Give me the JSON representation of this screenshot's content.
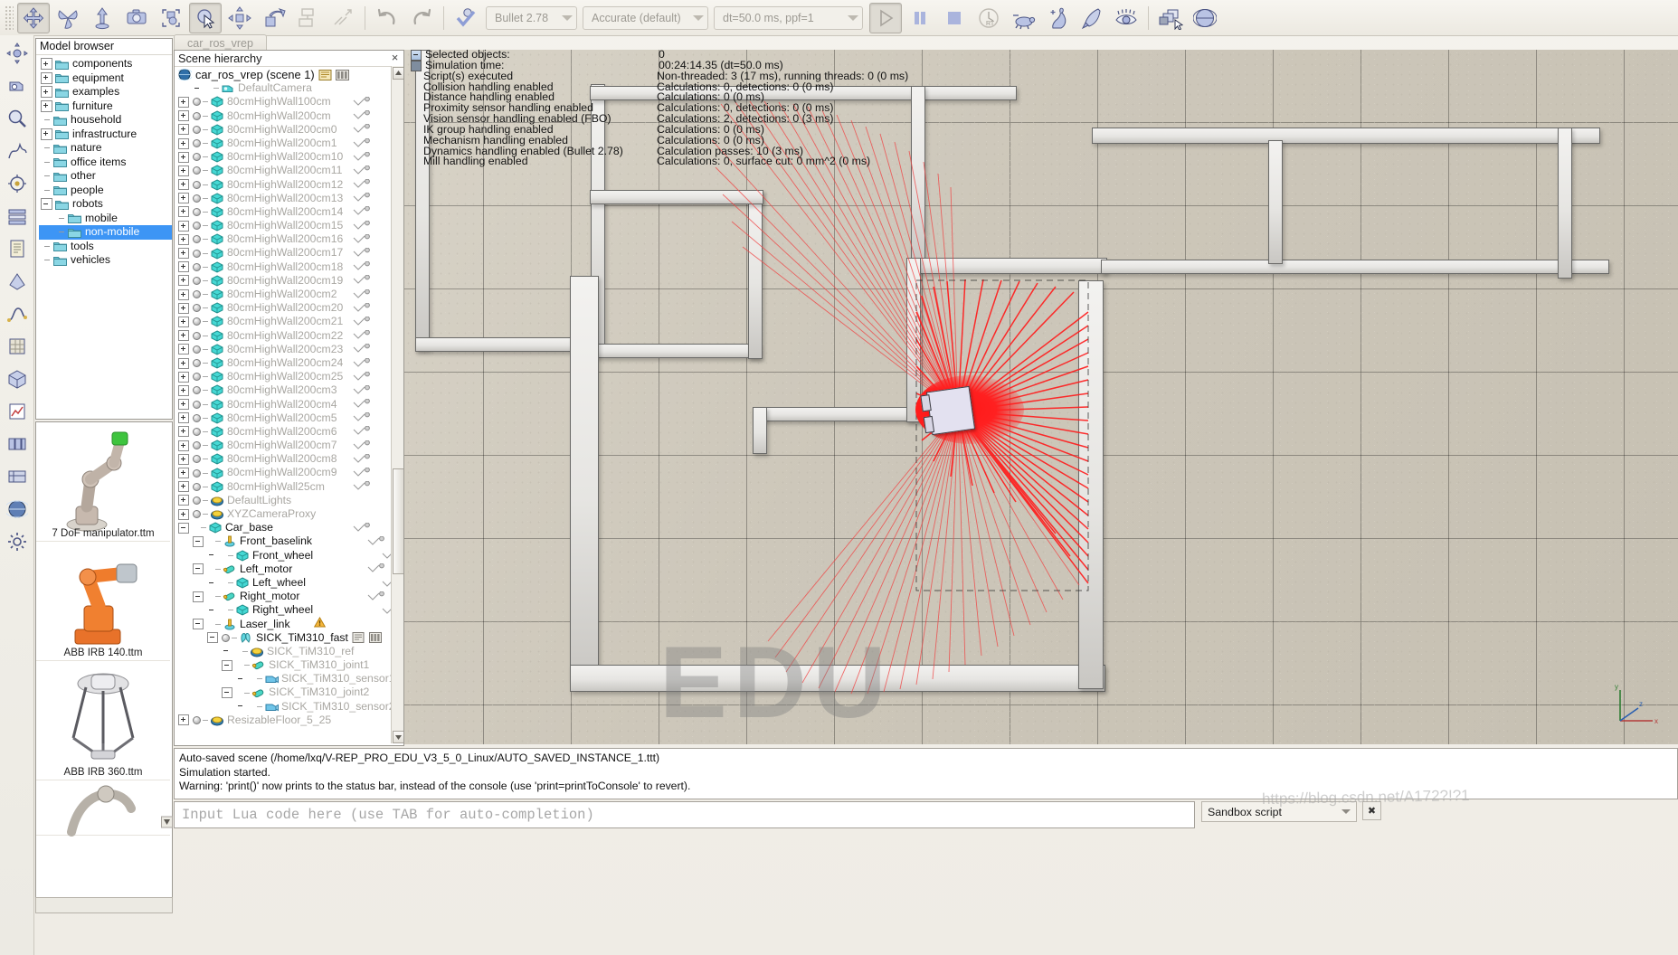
{
  "toolbar": {
    "icons": [
      "move-object-icon",
      "rotate-object-icon",
      "drag-up-icon",
      "camera-icon",
      "object-select-icon",
      "click-select-icon",
      "object-shift-icon",
      "object-rotate-icon",
      "assemble-icon",
      "disassemble-icon",
      "undo-icon",
      "redo-icon",
      "dynamics-toggle-icon"
    ],
    "engine_value": "Bullet 2.78",
    "accuracy_value": "Accurate (default)",
    "timestep_value": "dt=50.0 ms, ppf=1",
    "play_label": "start-simulation",
    "pause_label": "pause-simulation",
    "stop_label": "stop-simulation",
    "realtime_label": "real-time-mode",
    "slower_label": "slow-down-simulation",
    "faster_label": "speed-up-simulation",
    "threaded_label": "threaded-rendering",
    "visualize_label": "visualization-toggle",
    "pages_label": "page-selector",
    "scene_label": "scene-selector"
  },
  "rail": {
    "icons": [
      "scene-settings-icon",
      "camera-shift-icon",
      "zoom-icon",
      "dynamics-icon",
      "calculation-modules-icon",
      "collection-icon",
      "scripts-icon",
      "shape-edit-icon",
      "path-edit-icon",
      "texture-icon",
      "model-icon",
      "graph-icon",
      "layers-icon",
      "user-settings-icon",
      "environment-icon",
      "settings2-icon"
    ]
  },
  "model_browser": {
    "title": "Model browser",
    "items": [
      {
        "label": "components",
        "toggle": "plus",
        "indent": 0
      },
      {
        "label": "equipment",
        "toggle": "plus",
        "indent": 0
      },
      {
        "label": "examples",
        "toggle": "plus",
        "indent": 0
      },
      {
        "label": "furniture",
        "toggle": "plus",
        "indent": 0
      },
      {
        "label": "household",
        "toggle": "leaf",
        "indent": 0
      },
      {
        "label": "infrastructure",
        "toggle": "plus",
        "indent": 0
      },
      {
        "label": "nature",
        "toggle": "leaf",
        "indent": 0
      },
      {
        "label": "office items",
        "toggle": "leaf",
        "indent": 0
      },
      {
        "label": "other",
        "toggle": "leaf",
        "indent": 0
      },
      {
        "label": "people",
        "toggle": "leaf",
        "indent": 0
      },
      {
        "label": "robots",
        "toggle": "minus",
        "indent": 0
      },
      {
        "label": "mobile",
        "toggle": "leaf",
        "indent": 1
      },
      {
        "label": "non-mobile",
        "toggle": "leaf",
        "indent": 1,
        "selected": true
      },
      {
        "label": "tools",
        "toggle": "leaf",
        "indent": 0
      },
      {
        "label": "vehicles",
        "toggle": "leaf",
        "indent": 0
      }
    ],
    "thumbnails": [
      {
        "caption": "7 DoF manipulator.ttm",
        "kind": "arm"
      },
      {
        "caption": "ABB IRB 140.ttm",
        "kind": "irb140"
      },
      {
        "caption": "ABB IRB 360.ttm",
        "kind": "irb360"
      },
      {
        "caption": "",
        "kind": "partial"
      }
    ]
  },
  "scene_tab": {
    "label": "car_ros_vrep"
  },
  "hierarchy": {
    "title": "Scene hierarchy",
    "close_icon": "×",
    "root": "car_ros_vrep (scene 1)",
    "items": [
      {
        "label": "DefaultCamera",
        "indent": 1,
        "toggle": "blank",
        "dot": false,
        "icon": "camera",
        "dim": true,
        "sig": false
      },
      {
        "label": "80cmHighWall100cm",
        "indent": 0,
        "toggle": "plus",
        "dot": true,
        "icon": "shape",
        "dim": true,
        "sig": true
      },
      {
        "label": "80cmHighWall200cm",
        "indent": 0,
        "toggle": "plus",
        "dot": true,
        "icon": "shape",
        "dim": true,
        "sig": true
      },
      {
        "label": "80cmHighWall200cm0",
        "indent": 0,
        "toggle": "plus",
        "dot": true,
        "icon": "shape",
        "dim": true,
        "sig": true
      },
      {
        "label": "80cmHighWall200cm1",
        "indent": 0,
        "toggle": "plus",
        "dot": true,
        "icon": "shape",
        "dim": true,
        "sig": true
      },
      {
        "label": "80cmHighWall200cm10",
        "indent": 0,
        "toggle": "plus",
        "dot": true,
        "icon": "shape",
        "dim": true,
        "sig": true
      },
      {
        "label": "80cmHighWall200cm11",
        "indent": 0,
        "toggle": "plus",
        "dot": true,
        "icon": "shape",
        "dim": true,
        "sig": true
      },
      {
        "label": "80cmHighWall200cm12",
        "indent": 0,
        "toggle": "plus",
        "dot": true,
        "icon": "shape",
        "dim": true,
        "sig": true
      },
      {
        "label": "80cmHighWall200cm13",
        "indent": 0,
        "toggle": "plus",
        "dot": true,
        "icon": "shape",
        "dim": true,
        "sig": true
      },
      {
        "label": "80cmHighWall200cm14",
        "indent": 0,
        "toggle": "plus",
        "dot": true,
        "icon": "shape",
        "dim": true,
        "sig": true
      },
      {
        "label": "80cmHighWall200cm15",
        "indent": 0,
        "toggle": "plus",
        "dot": true,
        "icon": "shape",
        "dim": true,
        "sig": true
      },
      {
        "label": "80cmHighWall200cm16",
        "indent": 0,
        "toggle": "plus",
        "dot": true,
        "icon": "shape",
        "dim": true,
        "sig": true
      },
      {
        "label": "80cmHighWall200cm17",
        "indent": 0,
        "toggle": "plus",
        "dot": true,
        "icon": "shape",
        "dim": true,
        "sig": true
      },
      {
        "label": "80cmHighWall200cm18",
        "indent": 0,
        "toggle": "plus",
        "dot": true,
        "icon": "shape",
        "dim": true,
        "sig": true
      },
      {
        "label": "80cmHighWall200cm19",
        "indent": 0,
        "toggle": "plus",
        "dot": true,
        "icon": "shape",
        "dim": true,
        "sig": true
      },
      {
        "label": "80cmHighWall200cm2",
        "indent": 0,
        "toggle": "plus",
        "dot": true,
        "icon": "shape",
        "dim": true,
        "sig": true
      },
      {
        "label": "80cmHighWall200cm20",
        "indent": 0,
        "toggle": "plus",
        "dot": true,
        "icon": "shape",
        "dim": true,
        "sig": true
      },
      {
        "label": "80cmHighWall200cm21",
        "indent": 0,
        "toggle": "plus",
        "dot": true,
        "icon": "shape",
        "dim": true,
        "sig": true
      },
      {
        "label": "80cmHighWall200cm22",
        "indent": 0,
        "toggle": "plus",
        "dot": true,
        "icon": "shape",
        "dim": true,
        "sig": true
      },
      {
        "label": "80cmHighWall200cm23",
        "indent": 0,
        "toggle": "plus",
        "dot": true,
        "icon": "shape",
        "dim": true,
        "sig": true
      },
      {
        "label": "80cmHighWall200cm24",
        "indent": 0,
        "toggle": "plus",
        "dot": true,
        "icon": "shape",
        "dim": true,
        "sig": true
      },
      {
        "label": "80cmHighWall200cm25",
        "indent": 0,
        "toggle": "plus",
        "dot": true,
        "icon": "shape",
        "dim": true,
        "sig": true
      },
      {
        "label": "80cmHighWall200cm3",
        "indent": 0,
        "toggle": "plus",
        "dot": true,
        "icon": "shape",
        "dim": true,
        "sig": true
      },
      {
        "label": "80cmHighWall200cm4",
        "indent": 0,
        "toggle": "plus",
        "dot": true,
        "icon": "shape",
        "dim": true,
        "sig": true
      },
      {
        "label": "80cmHighWall200cm5",
        "indent": 0,
        "toggle": "plus",
        "dot": true,
        "icon": "shape",
        "dim": true,
        "sig": true
      },
      {
        "label": "80cmHighWall200cm6",
        "indent": 0,
        "toggle": "plus",
        "dot": true,
        "icon": "shape",
        "dim": true,
        "sig": true
      },
      {
        "label": "80cmHighWall200cm7",
        "indent": 0,
        "toggle": "plus",
        "dot": true,
        "icon": "shape",
        "dim": true,
        "sig": true
      },
      {
        "label": "80cmHighWall200cm8",
        "indent": 0,
        "toggle": "plus",
        "dot": true,
        "icon": "shape",
        "dim": true,
        "sig": true
      },
      {
        "label": "80cmHighWall200cm9",
        "indent": 0,
        "toggle": "plus",
        "dot": true,
        "icon": "shape",
        "dim": true,
        "sig": true
      },
      {
        "label": "80cmHighWall25cm",
        "indent": 0,
        "toggle": "plus",
        "dot": true,
        "icon": "shape",
        "dim": true,
        "sig": true
      },
      {
        "label": "DefaultLights",
        "indent": 0,
        "toggle": "plus",
        "dot": true,
        "icon": "light",
        "dim": true,
        "sig": false
      },
      {
        "label": "XYZCameraProxy",
        "indent": 0,
        "toggle": "plus",
        "dot": true,
        "icon": "light",
        "dim": true,
        "sig": false
      },
      {
        "label": "Car_base",
        "indent": 0,
        "toggle": "minus",
        "dot": false,
        "icon": "shape",
        "dim": false,
        "sig": true
      },
      {
        "label": "Front_baselink",
        "indent": 1,
        "toggle": "minus",
        "dot": false,
        "icon": "joint-f",
        "dim": false,
        "sig": true
      },
      {
        "label": "Front_wheel",
        "indent": 2,
        "toggle": "blank",
        "dot": false,
        "icon": "shape",
        "dim": false,
        "sig": true
      },
      {
        "label": "Left_motor",
        "indent": 1,
        "toggle": "minus",
        "dot": false,
        "icon": "joint-r",
        "dim": false,
        "sig": true
      },
      {
        "label": "Left_wheel",
        "indent": 2,
        "toggle": "blank",
        "dot": false,
        "icon": "shape",
        "dim": false,
        "sig": true
      },
      {
        "label": "Right_motor",
        "indent": 1,
        "toggle": "minus",
        "dot": false,
        "icon": "joint-r",
        "dim": false,
        "sig": true
      },
      {
        "label": "Right_wheel",
        "indent": 2,
        "toggle": "blank",
        "dot": false,
        "icon": "shape",
        "dim": false,
        "sig": true
      },
      {
        "label": "Laser_link",
        "indent": 1,
        "toggle": "minus",
        "dot": false,
        "icon": "joint-f",
        "dim": false,
        "sig": false,
        "warn": true
      },
      {
        "label": "SICK_TiM310_fast",
        "indent": 2,
        "toggle": "minus",
        "dot": true,
        "icon": "sensor-model",
        "dim": false,
        "sig": false,
        "script": true
      },
      {
        "label": "SICK_TiM310_ref",
        "indent": 3,
        "toggle": "blank",
        "dot": false,
        "icon": "light",
        "dim": true,
        "sig": false
      },
      {
        "label": "SICK_TiM310_joint1",
        "indent": 3,
        "toggle": "minus",
        "dot": false,
        "icon": "joint-r",
        "dim": true,
        "sig": false,
        "warn": true
      },
      {
        "label": "SICK_TiM310_sensor1",
        "indent": 4,
        "toggle": "blank",
        "dot": false,
        "icon": "vision",
        "dim": true,
        "sig": false
      },
      {
        "label": "SICK_TiM310_joint2",
        "indent": 3,
        "toggle": "minus",
        "dot": false,
        "icon": "joint-r",
        "dim": true,
        "sig": false,
        "warn": true
      },
      {
        "label": "SICK_TiM310_sensor2",
        "indent": 4,
        "toggle": "blank",
        "dot": false,
        "icon": "vision",
        "dim": true,
        "sig": false
      },
      {
        "label": "ResizableFloor_5_25",
        "indent": 0,
        "toggle": "plus",
        "dot": true,
        "icon": "light",
        "dim": true,
        "sig": false
      }
    ]
  },
  "viewport_status": [
    {
      "key": "Selected objects:",
      "value": "0",
      "btn": "minus"
    },
    {
      "key": "Simulation time:",
      "value": "00:24:14.35 (dt=50.0 ms)",
      "btn": "filled"
    },
    {
      "key": "Script(s) executed",
      "value": "Non-threaded: 3 (17 ms), running threads: 0 (0 ms)",
      "btn": "none"
    },
    {
      "key": "Collision handling enabled",
      "value": "Calculations: 0, detections: 0 (0 ms)",
      "btn": "none"
    },
    {
      "key": "Distance handling enabled",
      "value": "Calculations: 0 (0 ms)",
      "btn": "none"
    },
    {
      "key": "Proximity sensor handling enabled",
      "value": "Calculations: 0, detections: 0 (0 ms)",
      "btn": "none"
    },
    {
      "key": "Vision sensor handling enabled (FBO)",
      "value": "Calculations: 2, detections: 0 (3 ms)",
      "btn": "none"
    },
    {
      "key": "IK group handling enabled",
      "value": "Calculations: 0 (0 ms)",
      "btn": "none"
    },
    {
      "key": "Mechanism handling enabled",
      "value": "Calculations: 0 (0 ms)",
      "btn": "none"
    },
    {
      "key": "Dynamics handling enabled (Bullet 2.78)",
      "value": "Calculation passes: 10 (3 ms)",
      "btn": "none"
    },
    {
      "key": "Mill handling enabled",
      "value": "Calculations: 0, surface cut: 0 mm^2 (0 ms)",
      "btn": "none"
    }
  ],
  "viewport": {
    "watermark": "EDU",
    "axis_x": "x",
    "axis_y": "y",
    "axis_z": "z"
  },
  "status_console": {
    "lines": [
      "Auto-saved scene (/home/lxq/V-REP_PRO_EDU_V3_5_0_Linux/AUTO_SAVED_INSTANCE_1.ttt)",
      "Simulation started.",
      "Warning: 'print()' now prints to the status bar, instead of the console (use 'print=printToConsole' to revert)."
    ]
  },
  "lua_input": {
    "placeholder": "Input Lua code here (use TAB for auto-completion)",
    "value": ""
  },
  "sandbox": {
    "label": "Sandbox script",
    "close_icon": "✖"
  },
  "watermark_bottom": "https://blog.csdn.net/A172?!?1",
  "colors": {
    "selection_blue": "#3d95f5",
    "laser_red": "#ff1414",
    "shape_cyan": "#41d6d2",
    "accent_toolbar": "#aab4dd"
  }
}
